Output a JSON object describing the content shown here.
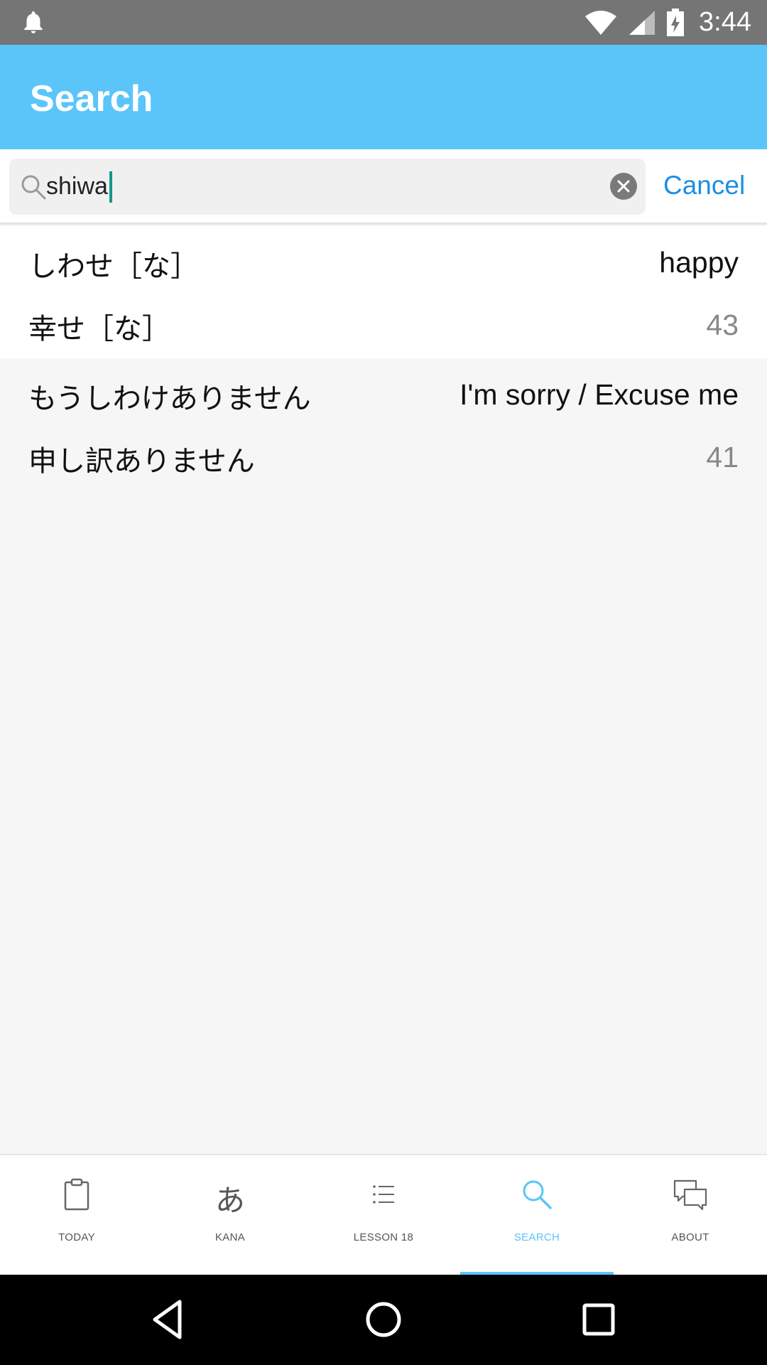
{
  "status_bar": {
    "time": "3:44"
  },
  "app_bar": {
    "title": "Search"
  },
  "search": {
    "query": "shiwa",
    "cancel_label": "Cancel"
  },
  "results": [
    {
      "kana": "しわせ［な］",
      "kanji": "幸せ［な］",
      "meaning": "happy",
      "lesson": "43"
    },
    {
      "kana": "もうしわけありません",
      "kanji": "申し訳ありません",
      "meaning": "I'm sorry / Excuse me",
      "lesson": "41"
    }
  ],
  "tabs": [
    {
      "label": "TODAY",
      "icon": "clipboard-icon"
    },
    {
      "label": "KANA",
      "icon": "kana-icon",
      "glyph": "あ"
    },
    {
      "label": "LESSON 18",
      "icon": "list-icon"
    },
    {
      "label": "SEARCH",
      "icon": "search-icon",
      "active": true
    },
    {
      "label": "ABOUT",
      "icon": "chat-bubbles-icon"
    }
  ],
  "colors": {
    "app_bar": "#5bc5f9",
    "accent": "#5bc5f9",
    "cancel": "#1a8fe3"
  }
}
